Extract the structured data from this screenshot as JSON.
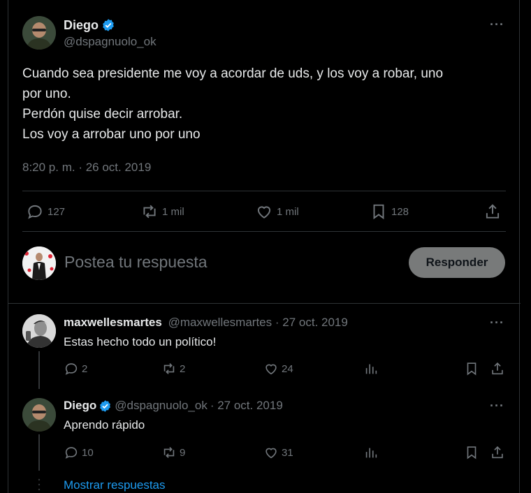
{
  "main_tweet": {
    "author_name": "Diego",
    "handle": "@dspagnuolo_ok",
    "text_lines": [
      "Cuando sea presidente me voy a acordar de uds, y los voy a robar, uno",
      "por uno.",
      "Perdón quise decir arrobar.",
      "Los voy a arrobar uno por uno"
    ],
    "timestamp": "8:20 p. m. · 26 oct. 2019",
    "stats": {
      "replies": "127",
      "reposts": "1 mil",
      "likes": "1 mil",
      "bookmarks": "128"
    },
    "more": "···"
  },
  "compose": {
    "placeholder": "Postea tu respuesta",
    "reply_button": "Responder"
  },
  "replies": [
    {
      "author_name": "maxwellesmartes",
      "handle": "@maxwellesmartes",
      "date": "· 27 oct. 2019",
      "text": "Estas hecho todo un político!",
      "stats": {
        "replies": "2",
        "reposts": "2",
        "likes": "24"
      },
      "more": "···"
    },
    {
      "author_name": "Diego",
      "handle": "@dspagnuolo_ok",
      "date": "· 27 oct. 2019",
      "text": "Aprendo rápido",
      "stats": {
        "replies": "10",
        "reposts": "9",
        "likes": "31"
      },
      "more": "···"
    }
  ],
  "show_replies": "Mostrar respuestas",
  "colors": {
    "background": "#000000",
    "text": "#e7e9ea",
    "muted": "#71767b",
    "verified": "#1d9bf0",
    "link": "#1d9bf0"
  },
  "icons": [
    "verified-badge-icon",
    "more-icon",
    "reply-icon",
    "repost-icon",
    "like-icon",
    "bookmark-icon",
    "share-icon",
    "views-icon"
  ]
}
